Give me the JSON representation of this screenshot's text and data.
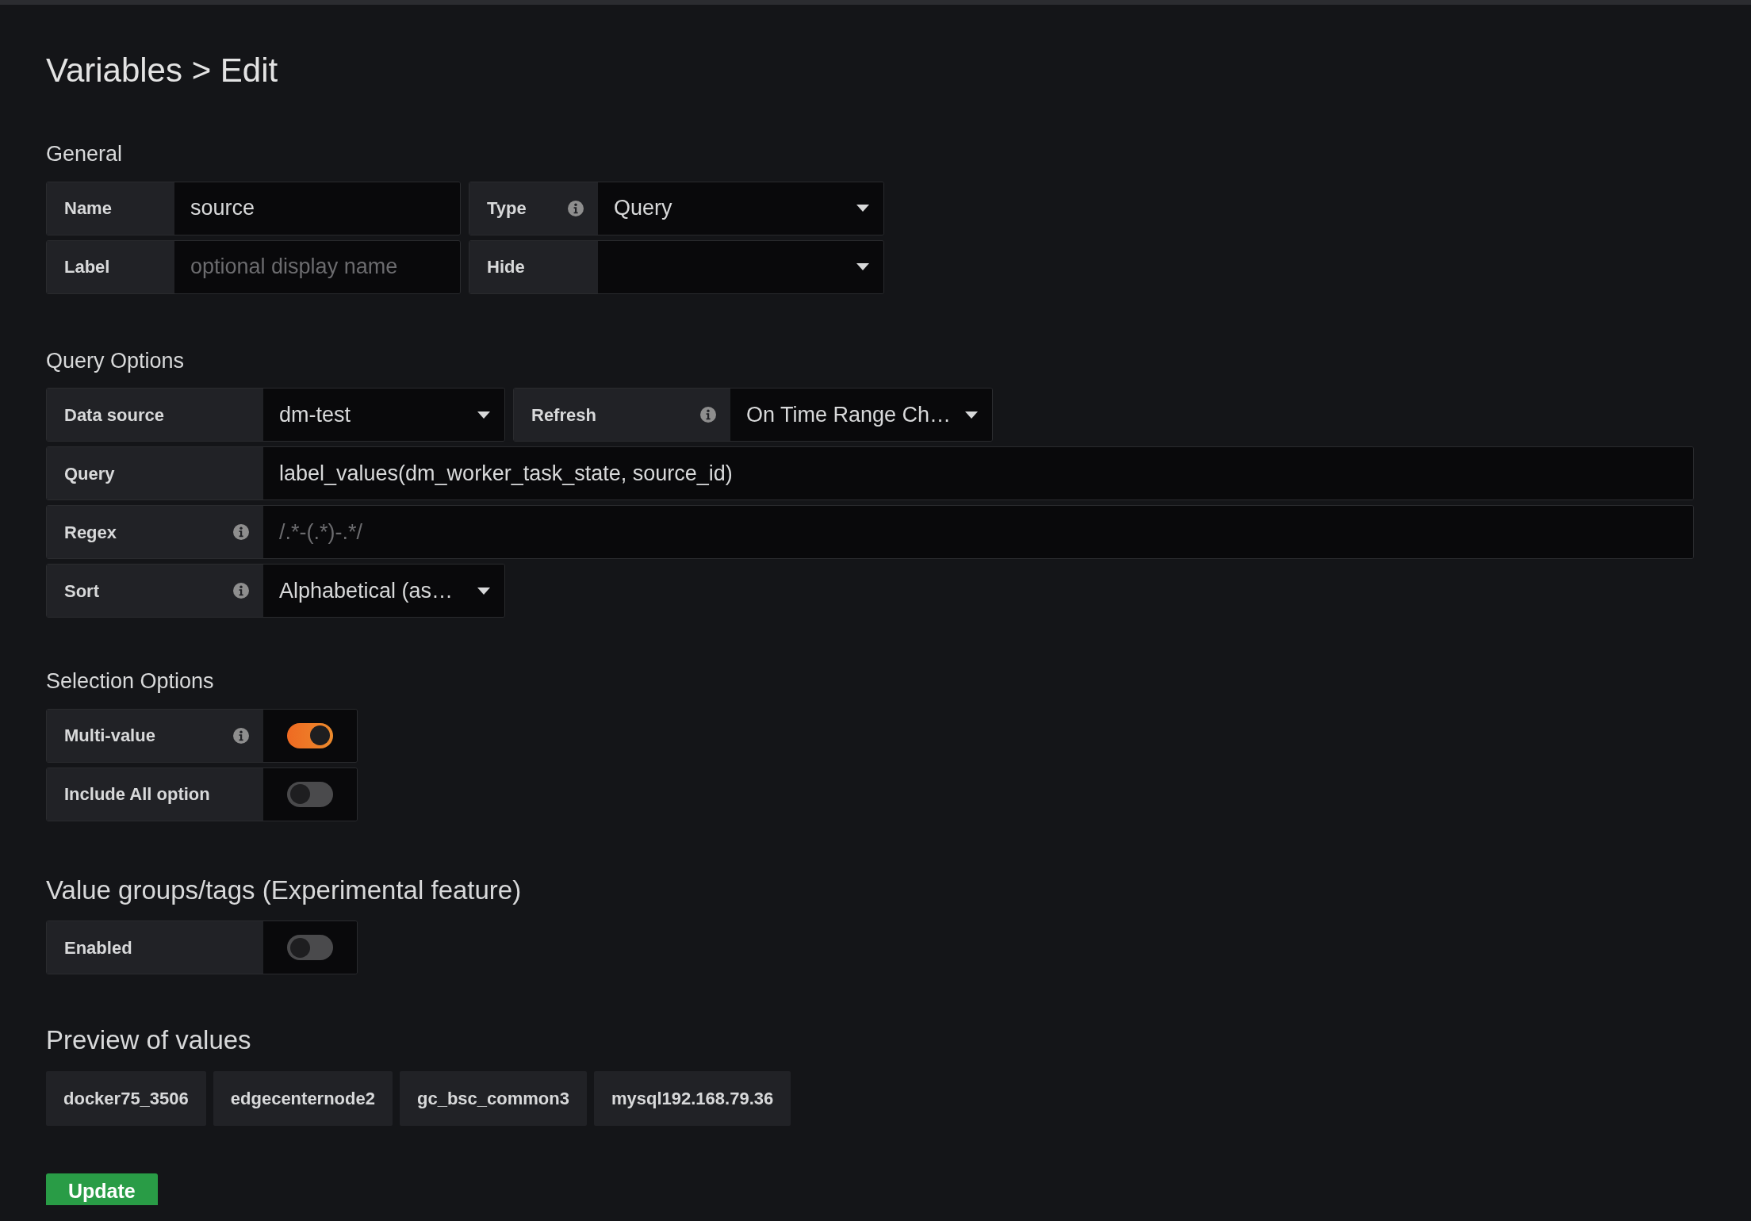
{
  "page_title": "Variables > Edit",
  "general": {
    "heading": "General",
    "rows": [
      [
        {
          "label": "Name",
          "info": false,
          "field": {
            "kind": "input",
            "value": "source"
          }
        },
        {
          "label": "Type",
          "info": true,
          "field": {
            "kind": "select",
            "value": "Query"
          }
        }
      ],
      [
        {
          "label": "Label",
          "info": false,
          "field": {
            "kind": "input",
            "placeholder": "optional display name"
          }
        },
        {
          "label": "Hide",
          "info": false,
          "field": {
            "kind": "select"
          }
        }
      ]
    ]
  },
  "query_options": {
    "heading": "Query Options",
    "rows": [
      [
        {
          "label": "Data source",
          "info": false,
          "field": {
            "kind": "select",
            "value": "dm-test"
          }
        },
        {
          "label": "Refresh",
          "info": true,
          "field": {
            "kind": "select",
            "value": "On Time Range Ch…"
          }
        }
      ],
      [
        {
          "label": "Query",
          "info": false,
          "field": {
            "kind": "input",
            "value": "label_values(dm_worker_task_state, source_id)"
          }
        }
      ],
      [
        {
          "label": "Regex",
          "info": true,
          "field": {
            "kind": "input",
            "placeholder": "/.*-(.*)-.*/"
          }
        }
      ],
      [
        {
          "label": "Sort",
          "info": true,
          "field": {
            "kind": "select",
            "value": "Alphabetical (as…"
          }
        }
      ]
    ]
  },
  "selection_options": {
    "heading": "Selection Options",
    "toggles": [
      {
        "label": "Multi-value",
        "info": true,
        "on": true
      },
      {
        "label": "Include All option",
        "info": false,
        "on": false
      }
    ]
  },
  "value_groups": {
    "heading": "Value groups/tags (Experimental feature)",
    "toggles": [
      {
        "label": "Enabled",
        "info": false,
        "on": false
      }
    ]
  },
  "preview": {
    "heading": "Preview of values",
    "values": [
      "docker75_3506",
      "edgecenternode2",
      "gc_bsc_common3",
      "mysql192.168.79.36"
    ]
  },
  "update_button": "Update"
}
